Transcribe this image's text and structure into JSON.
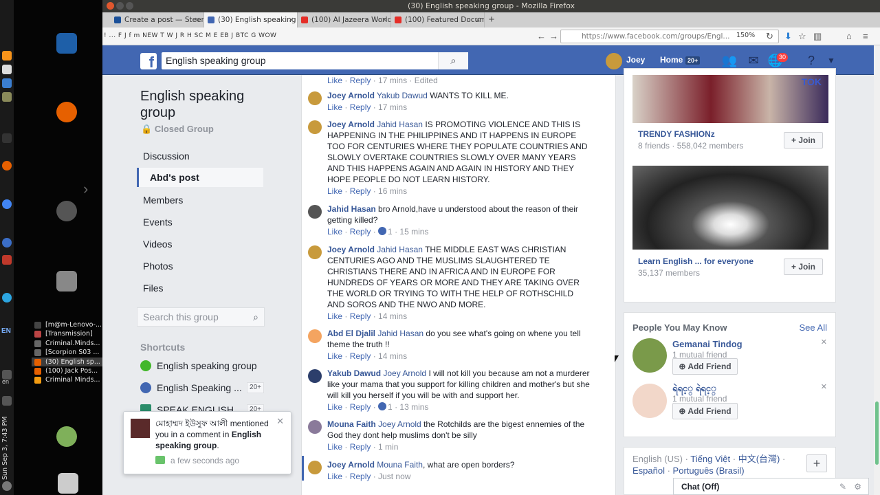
{
  "os": {
    "taskbar": [
      {
        "label": "[m@m-Lenovo-...",
        "color": "#444",
        "active": false
      },
      {
        "label": "[Transmission]",
        "color": "#b44",
        "active": false
      },
      {
        "label": "Criminal.Minds...",
        "color": "#666",
        "active": false
      },
      {
        "label": "[Scorpion S03 ...",
        "color": "#666",
        "active": false
      },
      {
        "label": "(30) English sp...",
        "color": "#e66000",
        "active": true
      },
      {
        "label": "(100) Jack Pos...",
        "color": "#e66000",
        "active": false
      },
      {
        "label": "Criminal Minds...",
        "color": "#f39c12",
        "active": false
      }
    ],
    "clock": "Sun Sep 3, 7:43 PM",
    "lang": "EN",
    "lang2": "en"
  },
  "browser": {
    "window_title": "(30) English speaking group - Mozilla Firefox",
    "tabs": [
      {
        "label": "Create a post — Steemit",
        "fav": "#1a5099",
        "active": false
      },
      {
        "label": "(30) English speaking gr...",
        "fav": "#4267b2",
        "active": true
      },
      {
        "label": "(100) Al Jazeera World",
        "fav": "#e52d27",
        "active": false
      },
      {
        "label": "(100) Featured Docume...",
        "fav": "#e52d27",
        "active": false
      }
    ],
    "new_tab": "+",
    "bookmarks_text": "! ... F J f m NEW T W J R H SC M E EB J BTC G WOW",
    "url": "https://www.facebook.com/groups/Engl...",
    "zoom": "150%"
  },
  "fb": {
    "search_value": "English speaking group",
    "user_name": "Joey",
    "home_label": "Home",
    "home_count": "20+",
    "notif_count": "30",
    "group": {
      "title": "English speaking group",
      "privacy": "Closed Group",
      "nav": [
        {
          "label": "Discussion",
          "active": false
        },
        {
          "label": "Abd's post",
          "active": true
        },
        {
          "label": "Members",
          "active": false
        },
        {
          "label": "Events",
          "active": false
        },
        {
          "label": "Videos",
          "active": false
        },
        {
          "label": "Photos",
          "active": false
        },
        {
          "label": "Files",
          "active": false
        }
      ],
      "search_placeholder": "Search this group",
      "shortcuts_title": "Shortcuts",
      "shortcuts": [
        {
          "label": "English speaking group",
          "badge": "",
          "color": "#42b72a"
        },
        {
          "label": "English Speaking ...",
          "badge": "20+",
          "color": "#4267b2"
        },
        {
          "label": "SPEAK ENGLISH ...",
          "badge": "20+",
          "color": "#2a8c6a"
        }
      ]
    },
    "comments": [
      {
        "author": "",
        "mention": "",
        "text": "",
        "actions": [
          "Like",
          "Reply"
        ],
        "likes": "",
        "time": "17 mins · Edited",
        "avatar": ""
      },
      {
        "author": "Joey Arnold",
        "mention": "Yakub Dawud",
        "text": "WANTS TO KILL ME.",
        "actions": [
          "Like",
          "Reply"
        ],
        "likes": "",
        "time": "17 mins",
        "avatar": "#c89a3c"
      },
      {
        "author": "Joey Arnold",
        "mention": "Jahid Hasan",
        "text": "IS PROMOTING VIOLENCE AND THIS IS HAPPENING IN THE PHILIPPINES AND IT HAPPENS IN EUROPE TOO FOR CENTURIES WHERE THEY POPULATE COUNTRIES AND SLOWLY OVERTAKE COUNTRIES SLOWLY OVER MANY YEARS AND THIS HAPPENS AGAIN AND AGAIN IN HISTORY AND THEY HOPE PEOPLE DO NOT LEARN HISTORY.",
        "actions": [
          "Like",
          "Reply"
        ],
        "likes": "",
        "time": "16 mins",
        "avatar": "#c89a3c"
      },
      {
        "author": "Jahid Hasan",
        "mention": "",
        "text": "bro Arnold,have u understood about the reason of their getting killed?",
        "actions": [
          "Like",
          "Reply"
        ],
        "likes": "1",
        "time": "15 mins",
        "avatar": "#555"
      },
      {
        "author": "Joey Arnold",
        "mention": "Jahid Hasan",
        "text": "THE MIDDLE EAST WAS CHRISTIAN CENTURIES AGO AND THE MUSLIMS SLAUGHTERED TE CHRISTIANS THERE AND IN AFRICA AND IN EUROPE FOR HUNDREDS OF YEARS OR MORE AND THEY ARE TAKING OVER THE WORLD OR TRYING TO WITH THE HELP OF ROTHSCHILD AND SOROS AND THE NWO AND MORE.",
        "actions": [
          "Like",
          "Reply"
        ],
        "likes": "",
        "time": "14 mins",
        "avatar": "#c89a3c"
      },
      {
        "author": "Abd El Djalil",
        "mention": "Jahid Hasan",
        "text": "do you see what's going on whene you tell theme the truth !!",
        "actions": [
          "Like",
          "Reply"
        ],
        "likes": "",
        "time": "14 mins",
        "avatar": "#f4a460"
      },
      {
        "author": "Yakub Dawud",
        "mention": "Joey Arnold",
        "text": "I will not kill you because am not a murderer like your mama that you support for killing children and mother's but she will kill you herself if you will be with and support her.",
        "actions": [
          "Like",
          "Reply"
        ],
        "likes": "1",
        "time": "13 mins",
        "avatar": "#2c3e6b"
      },
      {
        "author": "Mouna Faith",
        "mention": "Joey Arnold",
        "text": "the Rotchilds are the bigest ennemies of the God they dont help muslims don't be silly",
        "actions": [
          "Like",
          "Reply"
        ],
        "likes": "",
        "time": "1 min",
        "avatar": "#8a7a9a"
      },
      {
        "author": "Joey Arnold",
        "mention": "Mouna Faith",
        "text": ", what are open borders?",
        "actions": [
          "Like",
          "Reply"
        ],
        "likes": "",
        "time": "Just now",
        "avatar": "#c89a3c"
      }
    ],
    "right": {
      "groups": [
        {
          "name": "TRENDY FASHIONz",
          "meta": "8 friends · 558,042 members",
          "join": "Join",
          "overlay_text": "TOK"
        },
        {
          "name": "Learn English ... for everyone",
          "meta": "35,137 members",
          "join": "Join",
          "overlay_text": ""
        }
      ],
      "pymk_title": "People You May Know",
      "see_all": "See All",
      "people": [
        {
          "name": "Gemanai Tindog",
          "mutual": "1 mutual friend",
          "button": "Add Friend",
          "color": "#7a9a4a"
        },
        {
          "name": "ရဲရင့္ ရဲရင့္",
          "mutual": "1 mutual friend",
          "button": "Add Friend",
          "color": "#f2d7c9"
        }
      ],
      "languages": [
        "English (US)",
        "Tiếng Việt",
        "中文(台灣)",
        "Español",
        "Português (Brasil)"
      ],
      "lang_plus": "+"
    },
    "chat": "Chat (Off)",
    "notification": {
      "sender": "মোহাম্মদ ইউসুফ আলী",
      "action": "mentioned you in a comment in",
      "group": "English speaking group",
      "end": ".",
      "time": "a few seconds ago"
    }
  }
}
